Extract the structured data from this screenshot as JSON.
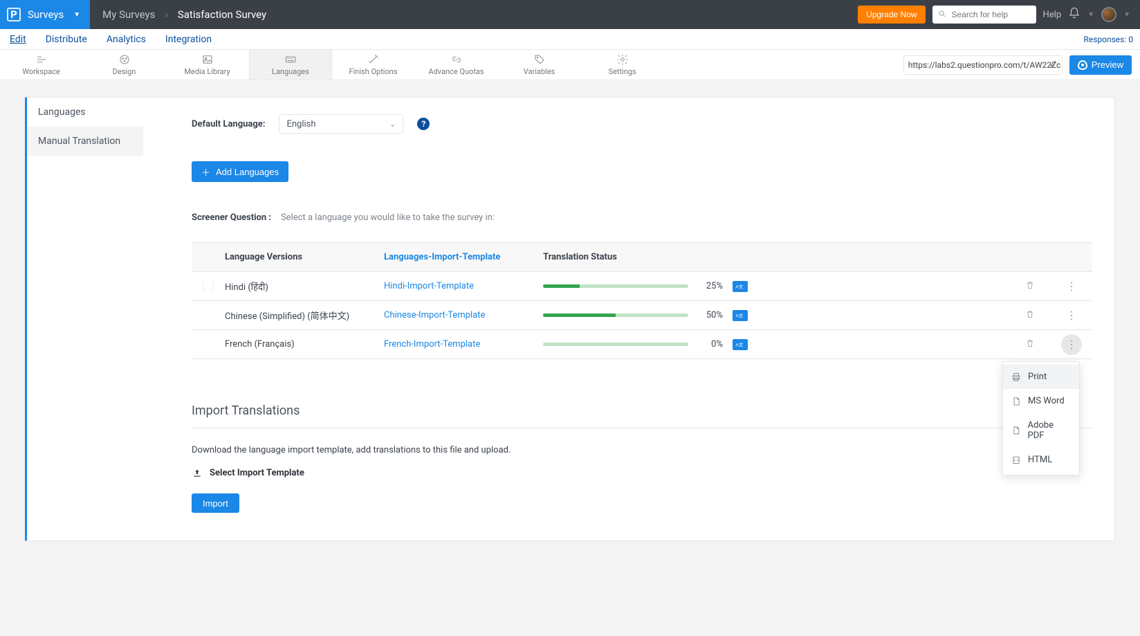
{
  "topbar": {
    "brand_label": "Surveys",
    "my_surveys": "My Surveys",
    "survey_title": "Satisfaction Survey",
    "upgrade": "Upgrade Now",
    "search_placeholder": "Search for help",
    "help": "Help"
  },
  "tabs": {
    "edit": "Edit",
    "distribute": "Distribute",
    "analytics": "Analytics",
    "integration": "Integration",
    "responses": "Responses: 0"
  },
  "toolbar": {
    "items": [
      {
        "label": "Workspace"
      },
      {
        "label": "Design"
      },
      {
        "label": "Media Library"
      },
      {
        "label": "Languages"
      },
      {
        "label": "Finish Options"
      },
      {
        "label": "Advance Quotas"
      },
      {
        "label": "Variables"
      },
      {
        "label": "Settings"
      }
    ],
    "url": "https://labs2.questionpro.com/t/AW22Zc",
    "preview": "Preview"
  },
  "side": {
    "languages": "Languages",
    "manual": "Manual Translation"
  },
  "default_language": {
    "label": "Default Language:",
    "value": "English"
  },
  "add_languages": "Add Languages",
  "screener": {
    "label": "Screener Question :",
    "text": "Select a language you would like to take the survey in:"
  },
  "table": {
    "col_versions": "Language Versions",
    "col_import_header": "Languages-Import-Template",
    "col_status": "Translation Status",
    "rows": [
      {
        "name": "Hindi (हिंदी)",
        "template": "Hindi-Import-Template",
        "pct": "25%",
        "fill": 25
      },
      {
        "name": "Chinese (Simplified) (简体中文)",
        "template": "Chinese-Import-Template",
        "pct": "50%",
        "fill": 50
      },
      {
        "name": "French (Français)",
        "template": "French-Import-Template",
        "pct": "0%",
        "fill": 0
      }
    ]
  },
  "menu": {
    "print": "Print",
    "word": "MS Word",
    "pdf": "Adobe PDF",
    "html": "HTML"
  },
  "import": {
    "title": "Import Translations",
    "desc": "Download the language import template, add translations to this file and upload.",
    "select": "Select Import Template",
    "button": "Import"
  }
}
